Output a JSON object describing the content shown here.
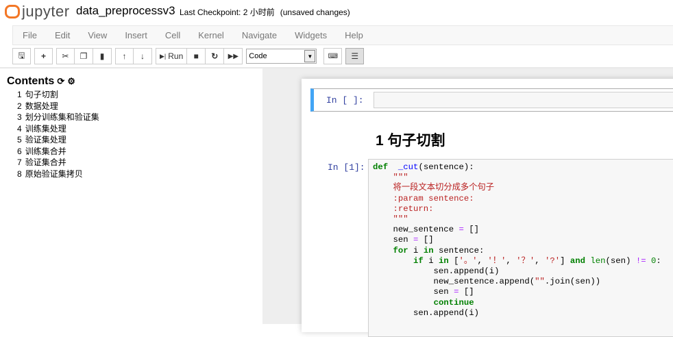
{
  "header": {
    "logo": "jupyter",
    "notebook_name": "data_preprocessv3",
    "checkpoint": "Last Checkpoint: 2 小时前",
    "unsaved": "(unsaved changes)"
  },
  "menu": [
    "File",
    "Edit",
    "View",
    "Insert",
    "Cell",
    "Kernel",
    "Navigate",
    "Widgets",
    "Help"
  ],
  "toolbar": {
    "run_label": "Run",
    "cell_type": "Code"
  },
  "toc": {
    "title": "Contents",
    "items": [
      {
        "n": "1",
        "label": "句子切割"
      },
      {
        "n": "2",
        "label": "数据处理"
      },
      {
        "n": "3",
        "label": "划分训练集和验证集"
      },
      {
        "n": "4",
        "label": "训练集处理"
      },
      {
        "n": "5",
        "label": "验证集处理"
      },
      {
        "n": "6",
        "label": "训练集合并"
      },
      {
        "n": "7",
        "label": "验证集合并"
      },
      {
        "n": "8",
        "label": "原始验证集拷贝"
      }
    ]
  },
  "cells": {
    "empty_prompt": "In  [ ]:",
    "heading": "1  句子切割",
    "code_prompt": "In  [1]:",
    "code_lines": [
      [
        [
          "kw",
          "def"
        ],
        [
          "",
          "  "
        ],
        [
          "fn",
          "_cut"
        ],
        [
          "",
          "(sentence):"
        ]
      ],
      [
        [
          "",
          "    "
        ],
        [
          "st",
          "\"\"\""
        ]
      ],
      [
        [
          "",
          "    "
        ],
        [
          "st",
          "将一段文本切分成多个句子"
        ]
      ],
      [
        [
          "",
          "    "
        ],
        [
          "st",
          ":param sentence:"
        ]
      ],
      [
        [
          "",
          "    "
        ],
        [
          "st",
          ":return:"
        ]
      ],
      [
        [
          "",
          "    "
        ],
        [
          "st",
          "\"\"\""
        ]
      ],
      [
        [
          "",
          "    new_sentence "
        ],
        [
          "op",
          "="
        ],
        [
          "",
          " []"
        ]
      ],
      [
        [
          "",
          "    sen "
        ],
        [
          "op",
          "="
        ],
        [
          "",
          " []"
        ]
      ],
      [
        [
          "",
          "    "
        ],
        [
          "kw",
          "for"
        ],
        [
          "",
          " i "
        ],
        [
          "kw",
          "in"
        ],
        [
          "",
          " sentence:"
        ]
      ],
      [
        [
          "",
          "        "
        ],
        [
          "kw",
          "if"
        ],
        [
          "",
          " i "
        ],
        [
          "kw",
          "in"
        ],
        [
          "",
          " ["
        ],
        [
          "st",
          "'。'"
        ],
        [
          "",
          ", "
        ],
        [
          "st",
          "'！'"
        ],
        [
          "",
          ", "
        ],
        [
          "st",
          "'？'"
        ],
        [
          "",
          ", "
        ],
        [
          "st",
          "'?'"
        ],
        [
          "",
          "] "
        ],
        [
          "kw",
          "and"
        ],
        [
          "",
          " "
        ],
        [
          "bi",
          "len"
        ],
        [
          "",
          "(sen) "
        ],
        [
          "op",
          "!="
        ],
        [
          "",
          " "
        ],
        [
          "nm",
          "0"
        ],
        [
          "",
          ":"
        ]
      ],
      [
        [
          "",
          "            sen.append(i)"
        ]
      ],
      [
        [
          "",
          "            new_sentence.append("
        ],
        [
          "st",
          "\"\""
        ],
        [
          "",
          ".join(sen))"
        ]
      ],
      [
        [
          "",
          "            sen "
        ],
        [
          "op",
          "="
        ],
        [
          "",
          " []"
        ]
      ],
      [
        [
          "",
          "            "
        ],
        [
          "kw",
          "continue"
        ]
      ],
      [
        [
          "",
          "        sen.append(i)"
        ]
      ]
    ]
  }
}
